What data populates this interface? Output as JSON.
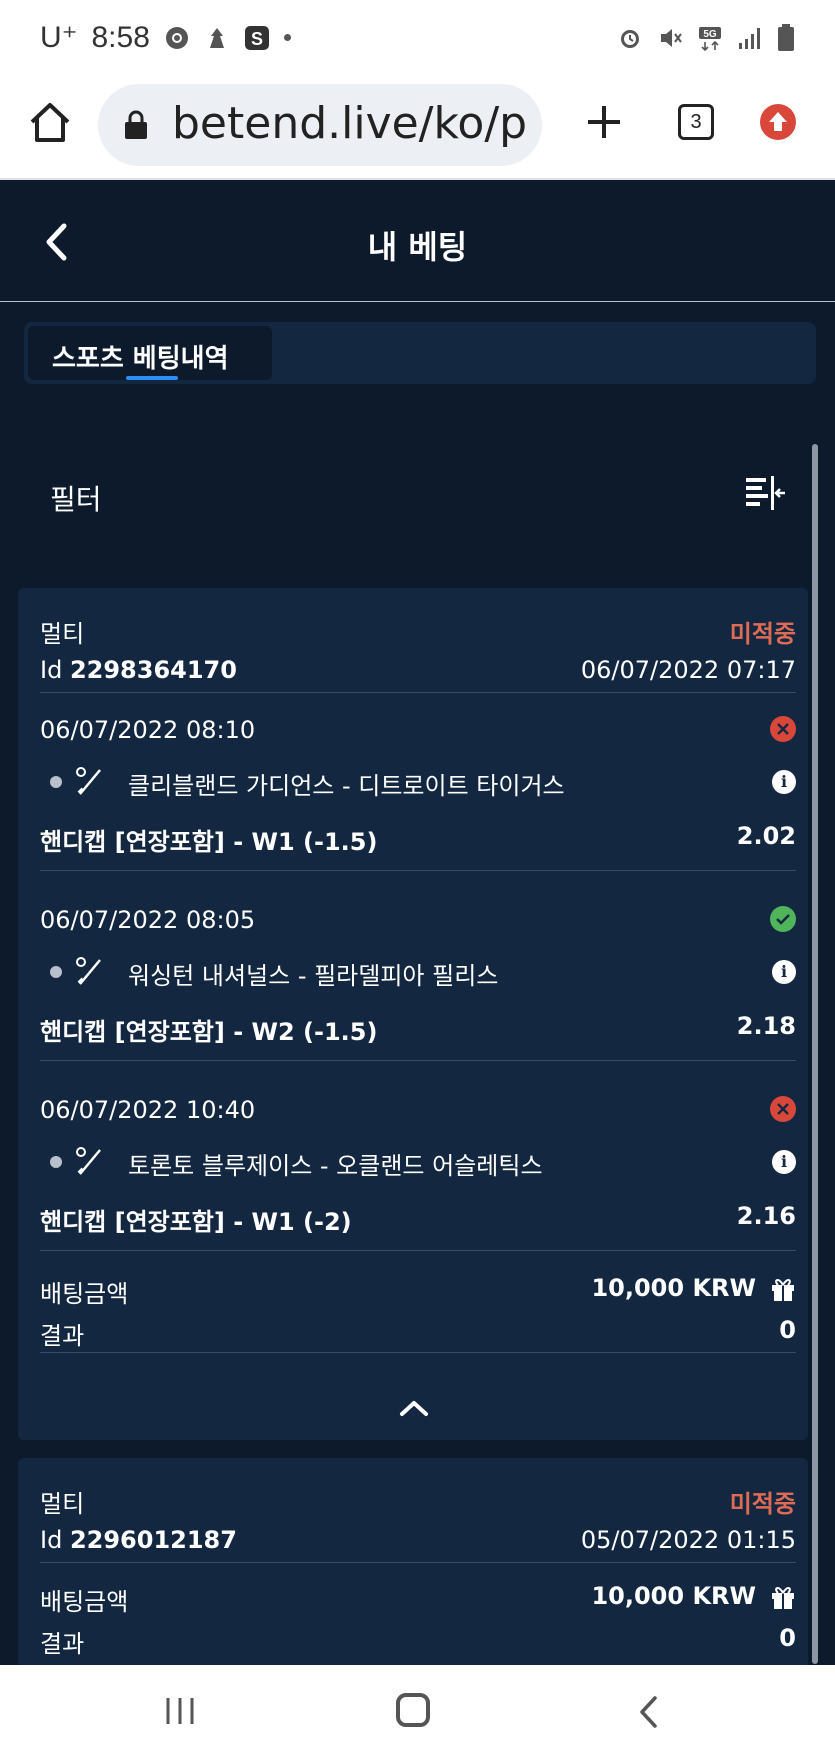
{
  "status_bar": {
    "carrier": "U⁺",
    "time": "8:58"
  },
  "browser": {
    "url": "betend.live/ko/p",
    "tab_count": "3"
  },
  "header": {
    "title": "내 베팅"
  },
  "tabs": [
    {
      "label": "스포츠 베팅내역",
      "active": true
    }
  ],
  "filter": {
    "label": "필터"
  },
  "bets": [
    {
      "type": "멀티",
      "status": "미적중",
      "id_label": "Id",
      "id": "2298364170",
      "placed": "06/07/2022 07:17",
      "selections": [
        {
          "datetime": "06/07/2022 08:10",
          "result": "lost",
          "match": "클리블랜드 가디언스 - 디트로이트 타이거스",
          "market": "핸디캡 [연장포함] - W1 (-1.5)",
          "odds": "2.02"
        },
        {
          "datetime": "06/07/2022 08:05",
          "result": "won",
          "match": "워싱턴 내셔널스 - 필라델피아 필리스",
          "market": "핸디캡 [연장포함] - W2 (-1.5)",
          "odds": "2.18"
        },
        {
          "datetime": "06/07/2022 10:40",
          "result": "lost",
          "match": "토론토 블루제이스 - 오클랜드 어슬레틱스",
          "market": "핸디캡 [연장포함] - W1 (-2)",
          "odds": "2.16"
        }
      ],
      "stake_label": "배팅금액",
      "stake": "10,000 KRW",
      "result_label": "결과",
      "result": "0"
    },
    {
      "type": "멀티",
      "status": "미적중",
      "id_label": "Id",
      "id": "2296012187",
      "placed": "05/07/2022 01:15",
      "stake_label": "배팅금액",
      "stake": "10,000 KRW",
      "result_label": "결과",
      "result": "0"
    }
  ],
  "colors": {
    "background": "#0d1a2b",
    "card": "#132840",
    "status_lost": "#e06b55",
    "won": "#4fb45a",
    "accent": "#2d8ef3"
  }
}
